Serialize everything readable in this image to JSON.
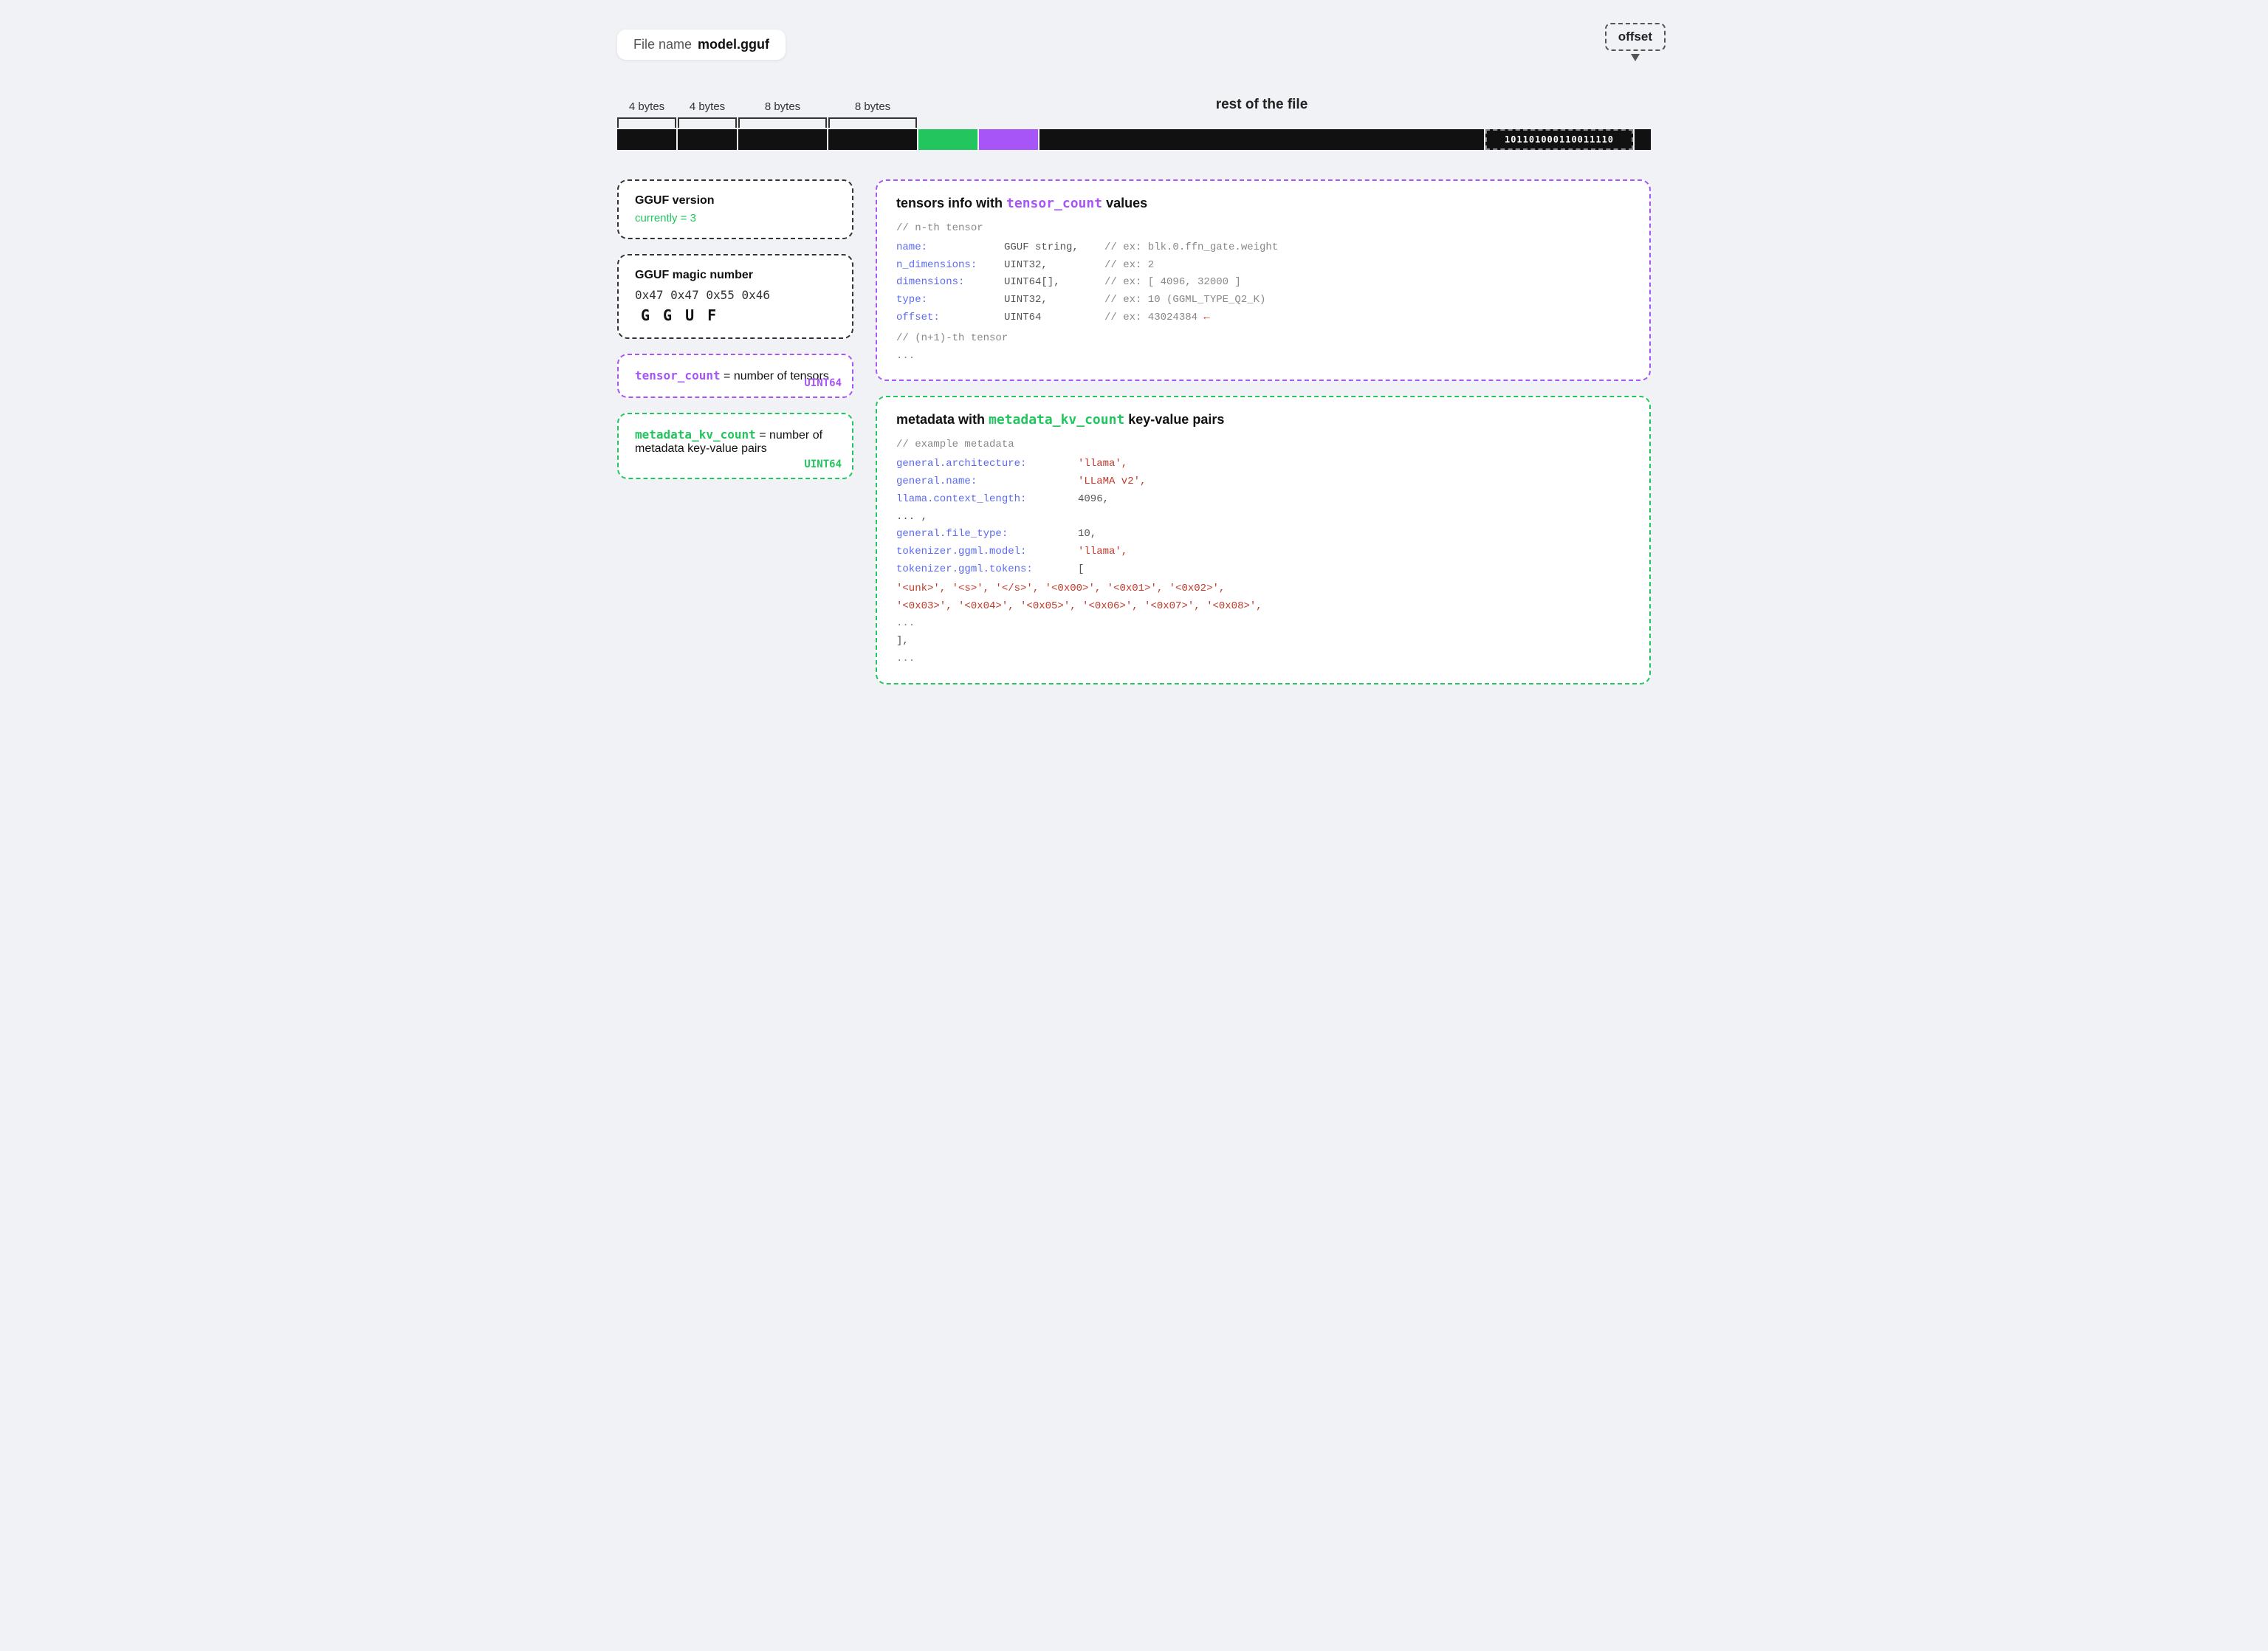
{
  "file": {
    "label": "File name",
    "name": "model.gguf"
  },
  "bar": {
    "labels": [
      "4 bytes",
      "4 bytes",
      "8 bytes",
      "8 bytes"
    ],
    "rest_label": "rest of the file",
    "binary_text": "101101000110011110",
    "offset_label": "offset"
  },
  "left_boxes": {
    "magic": {
      "title": "GGUF magic number",
      "hex": "0x47 0x47 0x55 0x46",
      "letters": [
        "G",
        "G",
        "U",
        "F"
      ]
    },
    "version": {
      "title": "GGUF version",
      "value": "currently = 3"
    },
    "tensor_count": {
      "label_purple": "tensor_count",
      "label_rest": " = number of tensors",
      "badge": "UINT64"
    },
    "metadata_count": {
      "label_green": "metadata_kv_count",
      "label_rest": " = number of metadata key-value pairs",
      "badge": "UINT64"
    }
  },
  "tensors_box": {
    "title": "tensors info with ",
    "title_mono": "tensor_count",
    "title_end": " values",
    "comment1": "// n-th tensor",
    "fields": [
      {
        "key": "name:",
        "type": "GGUF string,",
        "comment": "// ex: blk.0.ffn_gate.weight"
      },
      {
        "key": "n_dimensions:",
        "type": "UINT32,",
        "comment": "// ex: 2"
      },
      {
        "key": "dimensions:",
        "type": "UINT64[],",
        "comment": "// ex: [ 4096, 32000 ]"
      },
      {
        "key": "type:",
        "type": "UINT32,",
        "comment": "// ex: 10 (GGML_TYPE_Q2_K)"
      },
      {
        "key": "offset:",
        "type": "UINT64",
        "comment": "// ex: 43024384 ←"
      }
    ],
    "comment2": "// (n+1)-th tensor",
    "ellipsis": "..."
  },
  "metadata_box": {
    "title": "metadata with ",
    "title_mono": "metadata_kv_count",
    "title_end": " key-value pairs",
    "comment": "// example metadata",
    "lines": [
      {
        "key": "general.architecture:",
        "value": "'llama',"
      },
      {
        "key": "general.name:",
        "value": "'LLaMA v2',"
      },
      {
        "key": "llama.context_length:",
        "value": "4096,"
      },
      {
        "key": "... ,",
        "value": ""
      },
      {
        "key": "general.file_type:",
        "value": "10,"
      },
      {
        "key": "tokenizer.ggml.model:",
        "value": "'llama',"
      },
      {
        "key": "tokenizer.ggml.tokens:",
        "value": "["
      }
    ],
    "token_list_line1": "  '<unk>',  '<s>',    '</s>',   '<0x00>', '<0x01>', '<0x02>',",
    "token_list_line2": "  '<0x03>', '<0x04>', '<0x05>', '<0x06>', '<0x07>', '<0x08>',",
    "token_list_line3": "  ...",
    "close": "],",
    "end_ellipsis": "..."
  }
}
